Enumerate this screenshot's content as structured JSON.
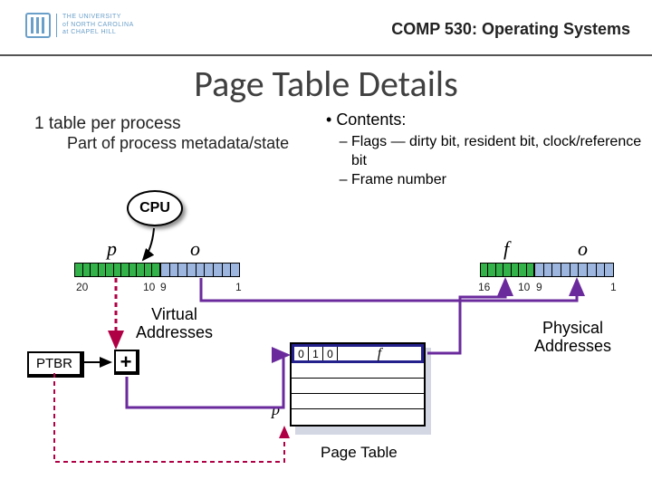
{
  "header": {
    "university_line1": "THE UNIVERSITY",
    "university_line2": "of NORTH CAROLINA",
    "university_line3": "at CHAPEL HILL",
    "course": "COMP 530: Operating Systems"
  },
  "title": "Page Table Details",
  "process_note": {
    "line1": "1 table per process",
    "line2": "Part of process metadata/state"
  },
  "contents": {
    "heading": "Contents:",
    "items": [
      "Flags — dirty bit, resident bit, clock/reference bit",
      "Frame number"
    ]
  },
  "cpu_label": "CPU",
  "virtual": {
    "p_label": "p",
    "o_label": "o",
    "p_bits": 11,
    "o_bits": 9,
    "tick_high": "20",
    "tick_mid_left": "10",
    "tick_mid_right": "9",
    "tick_low": "1"
  },
  "physical": {
    "f_label": "f",
    "o_label": "o",
    "f_bits": 7,
    "o_bits": 9,
    "tick_high": "16",
    "tick_mid_left": "10",
    "tick_mid_right": "9",
    "tick_low": "1"
  },
  "va_caption_line1": "Virtual",
  "va_caption_line2": "Addresses",
  "pa_caption_line1": "Physical",
  "pa_caption_line2": "Addresses",
  "ptbr": "PTBR",
  "plus": "+",
  "pagetable": {
    "flags": [
      "0",
      "1",
      "0"
    ],
    "frame_label": "f",
    "p_marker": "p",
    "caption": "Page Table"
  },
  "colors": {
    "green": "#33b24a",
    "blue_cell": "#9cb6e0",
    "purple": "#6a2a9c",
    "magenta": "#b00045",
    "navy": "#24218c"
  }
}
